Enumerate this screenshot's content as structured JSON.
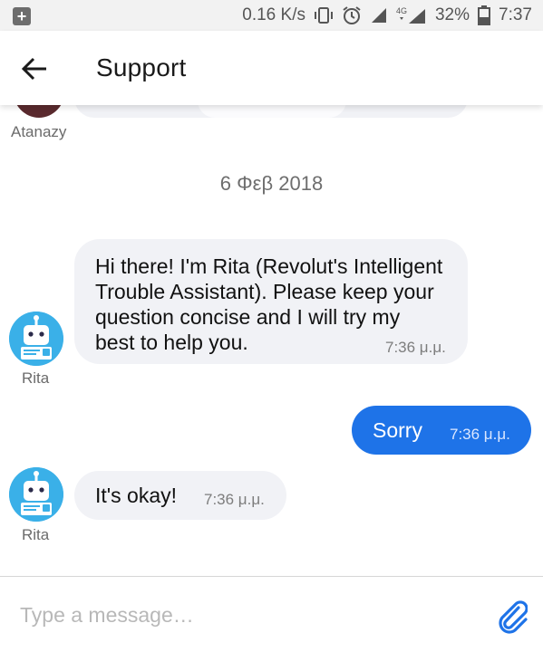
{
  "status_bar": {
    "speed": "0.16 K/s",
    "network": "4G",
    "battery": "32%",
    "time": "7:37",
    "icons": [
      "plus-notification-icon",
      "vibrate-icon",
      "alarm-icon",
      "signal-icon",
      "signal-4g-icon",
      "battery-icon"
    ]
  },
  "header": {
    "title": "Support",
    "back_icon": "arrow-left-icon"
  },
  "chat": {
    "previous_sender": "Atanazy",
    "date_separator": "6 Φεβ 2018",
    "messages": [
      {
        "sender": "Rita",
        "direction": "incoming",
        "lines": [
          "Hi there! I'm Rita (Revolut's Intelligent",
          "Trouble Assistant). Please keep your",
          "question concise and I will try my",
          "best to help you."
        ],
        "time": "7:36 μ.μ."
      },
      {
        "sender": "",
        "direction": "outgoing",
        "text": "Sorry",
        "time": "7:36 μ.μ."
      },
      {
        "sender": "Rita",
        "direction": "incoming",
        "text": "It's okay!",
        "time": "7:36 μ.μ."
      }
    ]
  },
  "composer": {
    "placeholder": "Type a message…",
    "value": "",
    "attach_icon": "paperclip-icon"
  },
  "colors": {
    "accent": "#1e73e8",
    "bubble_incoming": "#f1f2f6",
    "bot_avatar": "#3ab0e8"
  }
}
